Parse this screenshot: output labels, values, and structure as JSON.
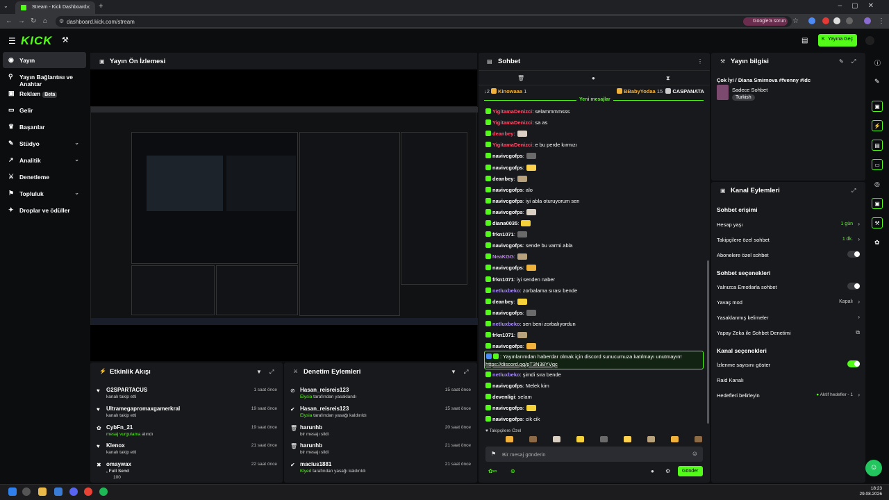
{
  "browser": {
    "tab_title": "Stream - Kick Dashboard",
    "url": "dashboard.kick.com/stream",
    "google_pill": "Google'a sorun"
  },
  "header": {
    "logo": "KICK",
    "go_live": "Yayına Geç"
  },
  "sidebar": {
    "items": [
      {
        "label": "Yayın",
        "icon": "broadcast-icon"
      },
      {
        "label": "Yayın Bağlantısı ve Anahtar",
        "icon": "link-icon"
      },
      {
        "label": "Reklam",
        "icon": "ad-icon",
        "badge": "Beta"
      },
      {
        "label": "Gelir",
        "icon": "money-icon"
      },
      {
        "label": "Başarılar",
        "icon": "trophy-icon"
      },
      {
        "label": "Stüdyo",
        "icon": "studio-icon",
        "chevron": true
      },
      {
        "label": "Analitik",
        "icon": "analytics-icon",
        "chevron": true
      },
      {
        "label": "Denetleme",
        "icon": "moderation-icon"
      },
      {
        "label": "Topluluk",
        "icon": "community-icon",
        "chevron": true
      },
      {
        "label": "Droplar ve ödüller",
        "icon": "gift-icon"
      }
    ]
  },
  "preview": {
    "title": "Yayın Ön İzlemesi"
  },
  "activity": {
    "title": "Etkinlik Akışı",
    "rows": [
      {
        "name": "G2SPARTACUS",
        "sub": "kanalı takip etti",
        "time": "1 saat önce"
      },
      {
        "name": "Ultramegapromaxgamerkral",
        "sub": "kanalı takip etti",
        "time": "19 saat önce"
      },
      {
        "name": "CybFn_21",
        "sub_hl": "mesaj vurgulama",
        "sub": " alındı",
        "time": "19 saat önce"
      },
      {
        "name": "Klenox",
        "sub": "kanalı takip etti",
        "time": "21 saat önce"
      },
      {
        "name": "omaywax",
        "sub_hl": ", Full Send",
        "sub": "100",
        "time": "22 saat önce"
      }
    ]
  },
  "modlog": {
    "title": "Denetim Eylemleri",
    "rows": [
      {
        "name": "Hasan_reisreis123",
        "hl": "Elysia",
        "sub": " tarafından yasaklandı",
        "time": "15 saat önce"
      },
      {
        "name": "Hasan_reisreis123",
        "hl": "Elysia",
        "sub": " tarafından yasağı kaldırıldı",
        "time": "15 saat önce"
      },
      {
        "name": "harunhb",
        "hl": "",
        "sub": "bir mesajı sildi",
        "time": "20 saat önce"
      },
      {
        "name": "harunhb",
        "hl": "",
        "sub": "bir mesajı sildi",
        "time": "21 saat önce"
      },
      {
        "name": "macius1881",
        "hl": "Klyed",
        "sub": " tarafından yasağı kaldırıldı",
        "time": "21 saat önce"
      }
    ]
  },
  "chat": {
    "title": "Sohbet",
    "leaderboard": {
      "rank": "2",
      "a": "Kinowaaa",
      "a_n": "1",
      "b": "BBabyYodaa",
      "b_n": "15",
      "c": "CASPANATA"
    },
    "new_messages": "Yeni mesajlar",
    "messages": [
      {
        "user": "YigitamaDenizci",
        "color": "#ff4d6d",
        "text": ": selammmmsss"
      },
      {
        "user": "YigitamaDenizci",
        "color": "#ff4d6d",
        "text": ": sa as"
      },
      {
        "user": "deanbey",
        "color": "#ff4d6d",
        "text": ":"
      },
      {
        "user": "YigitamaDenizci",
        "color": "#ff4d6d",
        "text": ": e bu perde kırmızı"
      },
      {
        "user": "navivcgofps",
        "color": "#fff",
        "text": ":"
      },
      {
        "user": "navivcgofps",
        "color": "#fff",
        "text": ":"
      },
      {
        "user": "deanbey",
        "color": "#fff",
        "text": ":"
      },
      {
        "user": "navivcgofps",
        "color": "#fff",
        "text": ": alo"
      },
      {
        "user": "navivcgofps",
        "color": "#fff",
        "text": ": iyi abla oturuyorum sen"
      },
      {
        "user": "navivcgofps",
        "color": "#fff",
        "text": ":"
      },
      {
        "user": "diana0035",
        "color": "#fff",
        "text": ":"
      },
      {
        "user": "frkn1071",
        "color": "#fff",
        "text": ":"
      },
      {
        "user": "navivcgofps",
        "color": "#fff",
        "text": ": sende bu varmi abla"
      },
      {
        "user": "NeaKGG",
        "color": "#c77dff",
        "text": ":"
      },
      {
        "user": "navivcgofps",
        "color": "#fff",
        "text": ":"
      },
      {
        "user": "frkn1071",
        "color": "#fff",
        "text": ": iyi senden naber"
      },
      {
        "user": "netluxbeko",
        "color": "#a78bfa",
        "text": ": zorbalama sırası bende"
      },
      {
        "user": "deanbey",
        "color": "#fff",
        "text": ":"
      },
      {
        "user": "navivcgofps",
        "color": "#fff",
        "text": ":"
      },
      {
        "user": "netluxbeko",
        "color": "#a78bfa",
        "text": ": sen beni zorbalıyordun"
      },
      {
        "user": "frkn1071",
        "color": "#fff",
        "text": ":"
      },
      {
        "user": "navivcgofps",
        "color": "#fff",
        "text": ":"
      }
    ],
    "pinned": {
      "user": "",
      "text": ": Yayınlarımdan haberdar olmak için discord sunucumuza katılmayı unutmayın!",
      "link": "https://discord.gg/pT3N38YVgc"
    },
    "after": [
      {
        "user": "netluxbeko",
        "color": "#a78bfa",
        "text": ": şimdi sıra bende"
      },
      {
        "user": "navivcgofps",
        "color": "#fff",
        "text": ": Melek kim"
      },
      {
        "user": "devenligi",
        "color": "#fff",
        "text": ": selam"
      },
      {
        "user": "navivcgofps",
        "color": "#fff",
        "text": ":"
      },
      {
        "user": "navivcgofps",
        "color": "#fff",
        "text": ": cik cik"
      }
    ],
    "followers_only": "Takipçilere Özel",
    "input_placeholder": "Bir mesaj gönderin",
    "send": "Gönder"
  },
  "info": {
    "title": "Yayın bilgisi",
    "stream_title": "Çok İyi / Diana Smirnova #fvenny #Idc",
    "category": "Sadece Sohbet",
    "language": "Turkish"
  },
  "actions": {
    "title": "Kanal Eylemleri",
    "chat_access": "Sohbet erişimi",
    "account_age": {
      "label": "Hesap yaşı",
      "value": "1 gün"
    },
    "followers_chat": {
      "label": "Takipçilere özel sohbet",
      "value": "1 dk."
    },
    "subs_chat": {
      "label": "Abonelere özel sohbet"
    },
    "chat_options": "Sohbet seçenekleri",
    "emote_only": {
      "label": "Yalnızca Emotlarla sohbet"
    },
    "slow_mode": {
      "label": "Yavaş mod",
      "value": "Kapalı"
    },
    "banned_words": {
      "label": "Yasaklanmış kelimeler"
    },
    "ai_moderation": {
      "label": "Yapay Zeka ile Sohbet Denetimi"
    },
    "channel_options": "Kanal seçenekleri",
    "viewer_count": {
      "label": "İzlenme sayısını göster"
    },
    "raid": {
      "label": "Raid Kanalı"
    },
    "goals": {
      "label": "Hedefleri belirleyin",
      "value": "Aktif hedefler - 1"
    }
  },
  "taskbar": {
    "time": "18:23",
    "date": "29.08.2026"
  },
  "colors": {
    "accent": "#53fc18",
    "panel": "#18191c",
    "bg": "#0b0d0f"
  }
}
